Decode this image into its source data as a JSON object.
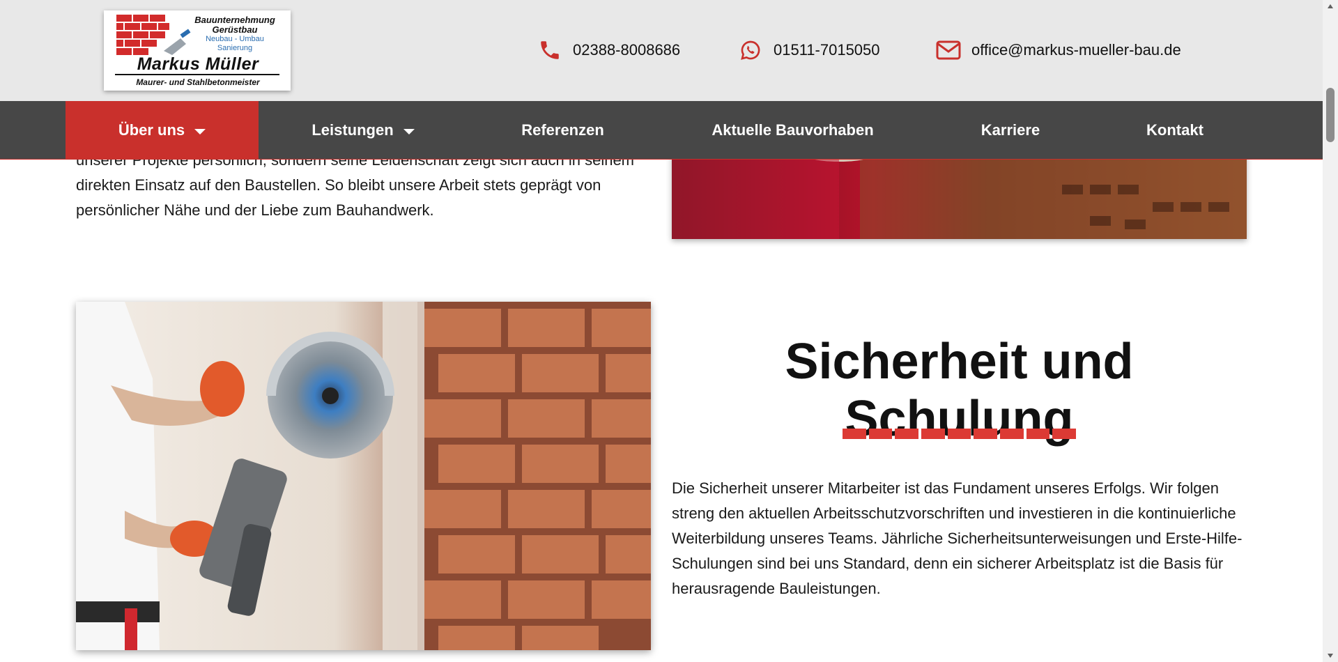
{
  "header": {
    "logo": {
      "line1": "Bauunternehmung",
      "line2": "Gerüstbau",
      "line3": "Neubau - Umbau",
      "line4": "Sanierung",
      "name": "Markus Müller",
      "subtitle": "Maurer- und Stahlbetonmeister"
    },
    "contacts": {
      "phone": "02388-8008686",
      "whatsapp": "01511-7015050",
      "email": "office@markus-mueller-bau.de"
    },
    "icons": {
      "phone": "phone-icon",
      "whatsapp": "whatsapp-icon",
      "email": "envelope-icon"
    }
  },
  "nav": {
    "items": [
      {
        "label": "Über uns",
        "active": true,
        "dropdown": true
      },
      {
        "label": "Leistungen",
        "active": false,
        "dropdown": true
      },
      {
        "label": "Referenzen",
        "active": false,
        "dropdown": false
      },
      {
        "label": "Aktuelle Bauvorhaben",
        "active": false,
        "dropdown": false
      },
      {
        "label": "Karriere",
        "active": false,
        "dropdown": false
      },
      {
        "label": "Kontakt",
        "active": false,
        "dropdown": false
      }
    ]
  },
  "content": {
    "top_paragraph": "unserer Projekte persönlich, sondern seine Leidenschaft zeigt sich auch in seinem direkten Einsatz auf den Baustellen. So bleibt unsere Arbeit stets geprägt von persönlicher Nähe und der Liebe zum Bauhandwerk.",
    "section_heading": "Sicherheit und Schulung",
    "section_paragraph": "Die Sicherheit unserer Mitarbeiter ist das Fundament unseres Erfolgs. Wir folgen streng den aktuellen Arbeitsschutzvorschriften und investieren in die kontinuierliche Weiterbildung unseres Teams. Jährliche Sicherheitsunterweisungen und Erste-Hilfe-Schulungen sind bei uns Standard, denn ein sicherer Arbeitsplatz ist die Basis für herausragende Bauleistungen."
  },
  "colors": {
    "accent": "#c9302c",
    "nav_bg": "#474747",
    "header_bg": "#e8e8e8",
    "divider": "#dc3a34"
  }
}
